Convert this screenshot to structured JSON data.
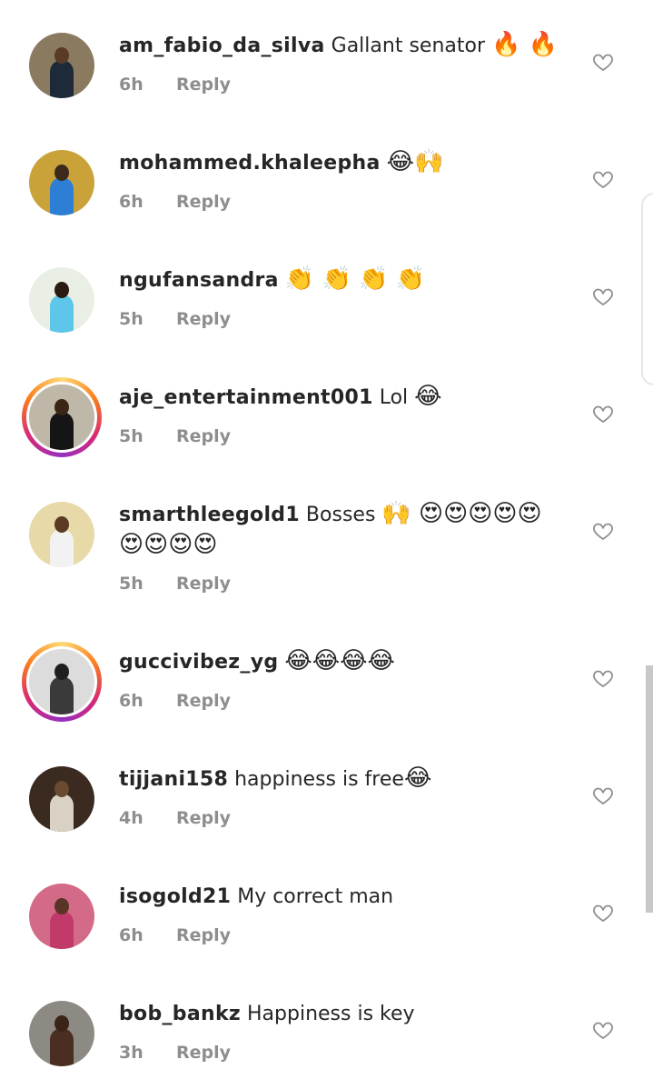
{
  "colors": {
    "text": "#262626",
    "meta": "#8e8e8e",
    "heart": "#8e8e8e",
    "story_ring": "#d62976"
  },
  "reply_label": "Reply",
  "comments": [
    {
      "username": "am_fabio_da_silva",
      "text": " Gallant senator ",
      "emoji": "🔥 🔥",
      "time": "6h",
      "story_ring": false,
      "avatar_bg": "#8a7a60",
      "avatar_fig": "#1e2a3a",
      "avatar_head": "#5a3b26"
    },
    {
      "username": "mohammed.khaleepha",
      "text": " ",
      "emoji": "😂🙌",
      "time": "6h",
      "story_ring": false,
      "avatar_bg": "#c9a33a",
      "avatar_fig": "#2d7fd6",
      "avatar_head": "#3e2a1c"
    },
    {
      "username": "ngufansandra",
      "text": " ",
      "emoji": "👏 👏 👏 👏",
      "time": "5h",
      "story_ring": false,
      "avatar_bg": "#e9efe4",
      "avatar_fig": "#5ec6e8",
      "avatar_head": "#2a1a12"
    },
    {
      "username": "aje_entertainment001",
      "text": " Lol ",
      "emoji": "😂",
      "time": "5h",
      "story_ring": true,
      "avatar_bg": "#bfb7a8",
      "avatar_fig": "#151515",
      "avatar_head": "#3b2616"
    },
    {
      "username": "smarthleegold1",
      "text": " Bosses ",
      "emoji": "🙌 😍😍😍😍😍",
      "emoji2": "😍😍😍😍",
      "time": "5h",
      "story_ring": false,
      "avatar_bg": "#e8d9a8",
      "avatar_fig": "#f2f2f2",
      "avatar_head": "#5a3a22"
    },
    {
      "username": "guccivibez_yg",
      "text": " ",
      "emoji": "😂😂😂😂",
      "time": "6h",
      "story_ring": true,
      "avatar_bg": "#dcdcdc",
      "avatar_fig": "#3a3a3a",
      "avatar_head": "#1f1f1f"
    },
    {
      "username": "tijjani158",
      "text": " happiness is free",
      "emoji": "😂",
      "time": "4h",
      "story_ring": false,
      "avatar_bg": "#3a2a20",
      "avatar_fig": "#d9d2c4",
      "avatar_head": "#6b4a32"
    },
    {
      "username": "isogold21",
      "text": " My correct man",
      "emoji": "",
      "time": "6h",
      "story_ring": false,
      "avatar_bg": "#d26a88",
      "avatar_fig": "#c23a6a",
      "avatar_head": "#5a3424"
    },
    {
      "username": "bob_bankz",
      "text": " Happiness is key",
      "emoji": "",
      "time": "3h",
      "story_ring": false,
      "avatar_bg": "#8d8a84",
      "avatar_fig": "#4a2e22",
      "avatar_head": "#3a2418"
    }
  ]
}
